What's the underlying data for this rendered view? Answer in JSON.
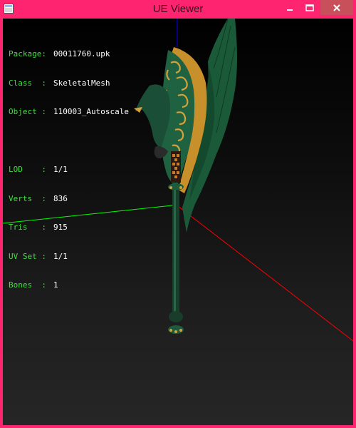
{
  "window": {
    "title": "UE Viewer",
    "title_bar_color": "#ff2470",
    "close_button_color": "#c7505a"
  },
  "controls": {
    "minimize_icon": "minimize-icon",
    "maximize_icon": "maximize-icon",
    "close_icon": "close-icon"
  },
  "info": {
    "package": {
      "label": "Package:",
      "value": "00011760.upk"
    },
    "class": {
      "label": "Class  :",
      "value": "SkeletalMesh"
    },
    "object": {
      "label": "Object :",
      "value": "110003_Autoscale"
    },
    "lod": {
      "label": "LOD    :",
      "value": "1/1"
    },
    "verts": {
      "label": "Verts  :",
      "value": "836"
    },
    "tris": {
      "label": "Tris   :",
      "value": "915"
    },
    "uvset": {
      "label": "UV Set :",
      "value": "1/1"
    },
    "bones": {
      "label": "Bones  :",
      "value": "1"
    }
  },
  "colors": {
    "label_green": "#3ee03e",
    "axis_x": "#ff0000",
    "axis_y": "#00ff00",
    "axis_z": "#0000ff",
    "weapon_green": "#1e5b3c",
    "weapon_gold": "#d49a2a"
  }
}
